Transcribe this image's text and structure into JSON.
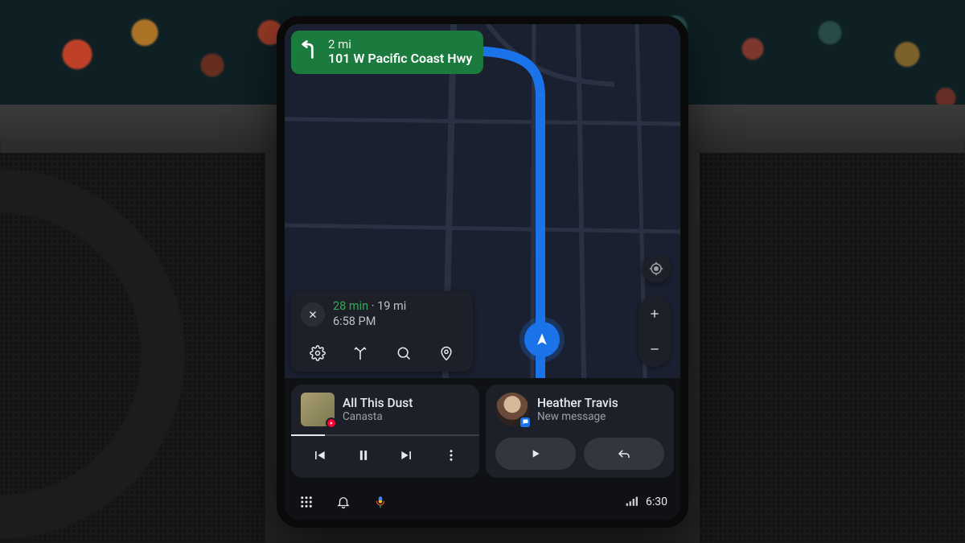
{
  "navigation": {
    "turn": {
      "distance": "2 mi",
      "road": "101 W Pacific Coast Hwy",
      "maneuver": "turn-left"
    },
    "eta": {
      "duration": "28 min",
      "distance": "19 mi",
      "arrival": "6:58 PM"
    }
  },
  "media": {
    "track_title": "All This Dust",
    "artist": "Canasta",
    "progress_pct": 18
  },
  "message": {
    "sender": "Heather Travis",
    "status": "New message"
  },
  "statusbar": {
    "time": "6:30"
  }
}
